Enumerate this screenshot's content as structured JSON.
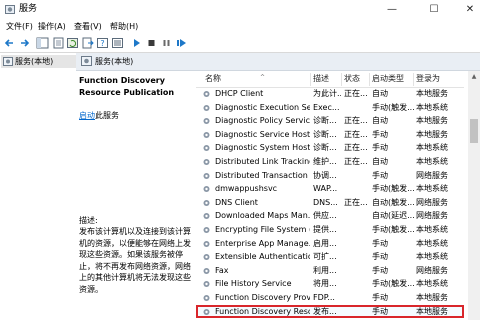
{
  "window": {
    "title": "服务",
    "min_glyph": "—",
    "max_glyph": "☐",
    "close_glyph": "✕"
  },
  "menu": [
    {
      "label": "文件(F)"
    },
    {
      "label": "操作(A)"
    },
    {
      "label": "查看(V)"
    },
    {
      "label": "帮助(H)"
    }
  ],
  "toolbar": [
    "back-icon",
    "forward-icon",
    "console-tree-icon",
    "properties-icon",
    "refresh-icon",
    "export-icon",
    "help-icon",
    "details-icon",
    "start-service-icon",
    "stop-service-icon",
    "pause-service-icon",
    "restart-service-icon"
  ],
  "tree": {
    "selected_label": "服务(本地)"
  },
  "header_band": {
    "label": "服务(本地)"
  },
  "description": {
    "title": "Function Discovery Resource Publication",
    "action_link": "启动",
    "action_suffix": "此服务",
    "heading": "描述:",
    "body": "发布该计算机以及连接到该计算机的资源，以便能够在网络上发现这些资源。如果该服务被停止，将不再发布网络资源，网络上的其他计算机将无法发现这些资源。"
  },
  "columns": {
    "name": "名称",
    "desc": "描述",
    "status": "状态",
    "startup": "启动类型",
    "logon": "登录为"
  },
  "services": [
    {
      "name": "DHCP Client",
      "desc": "为此计...",
      "status": "正在...",
      "startup": "自动",
      "logon": "本地服务"
    },
    {
      "name": "Diagnostic Execution Ser...",
      "desc": "Exec...",
      "status": "",
      "startup": "手动(触发...",
      "logon": "本地系统"
    },
    {
      "name": "Diagnostic Policy Service",
      "desc": "诊断...",
      "status": "正在...",
      "startup": "自动",
      "logon": "本地服务"
    },
    {
      "name": "Diagnostic Service Host",
      "desc": "诊断...",
      "status": "正在...",
      "startup": "手动",
      "logon": "本地服务"
    },
    {
      "name": "Diagnostic System Host",
      "desc": "诊断...",
      "status": "正在...",
      "startup": "手动",
      "logon": "本地系统"
    },
    {
      "name": "Distributed Link Tracking...",
      "desc": "维护...",
      "status": "正在...",
      "startup": "自动",
      "logon": "本地系统"
    },
    {
      "name": "Distributed Transaction C...",
      "desc": "协调...",
      "status": "",
      "startup": "手动",
      "logon": "网络服务"
    },
    {
      "name": "dmwappushsvc",
      "desc": "WAP...",
      "status": "",
      "startup": "手动(触发...",
      "logon": "本地系统"
    },
    {
      "name": "DNS Client",
      "desc": "DNS...",
      "status": "正在...",
      "startup": "自动(触发...",
      "logon": "网络服务"
    },
    {
      "name": "Downloaded Maps Man...",
      "desc": "供应...",
      "status": "",
      "startup": "自动(延迟...",
      "logon": "网络服务"
    },
    {
      "name": "Encrypting File System (E...",
      "desc": "提供...",
      "status": "",
      "startup": "手动(触发...",
      "logon": "本地系统"
    },
    {
      "name": "Enterprise App Manage...",
      "desc": "启用...",
      "status": "",
      "startup": "手动",
      "logon": "本地系统"
    },
    {
      "name": "Extensible Authenticatio...",
      "desc": "可扩...",
      "status": "",
      "startup": "手动",
      "logon": "本地系统"
    },
    {
      "name": "Fax",
      "desc": "利用...",
      "status": "",
      "startup": "手动",
      "logon": "网络服务"
    },
    {
      "name": "File History Service",
      "desc": "将用...",
      "status": "",
      "startup": "手动(触发...",
      "logon": "本地系统"
    },
    {
      "name": "Function Discovery Provi...",
      "desc": "FDP...",
      "status": "",
      "startup": "手动",
      "logon": "本地服务"
    },
    {
      "name": "Function Discovery Reso...",
      "desc": "发布...",
      "status": "",
      "startup": "手动",
      "logon": "本地服务",
      "highlighted": true
    }
  ],
  "scrollbar": {
    "up_glyph": "▲"
  }
}
